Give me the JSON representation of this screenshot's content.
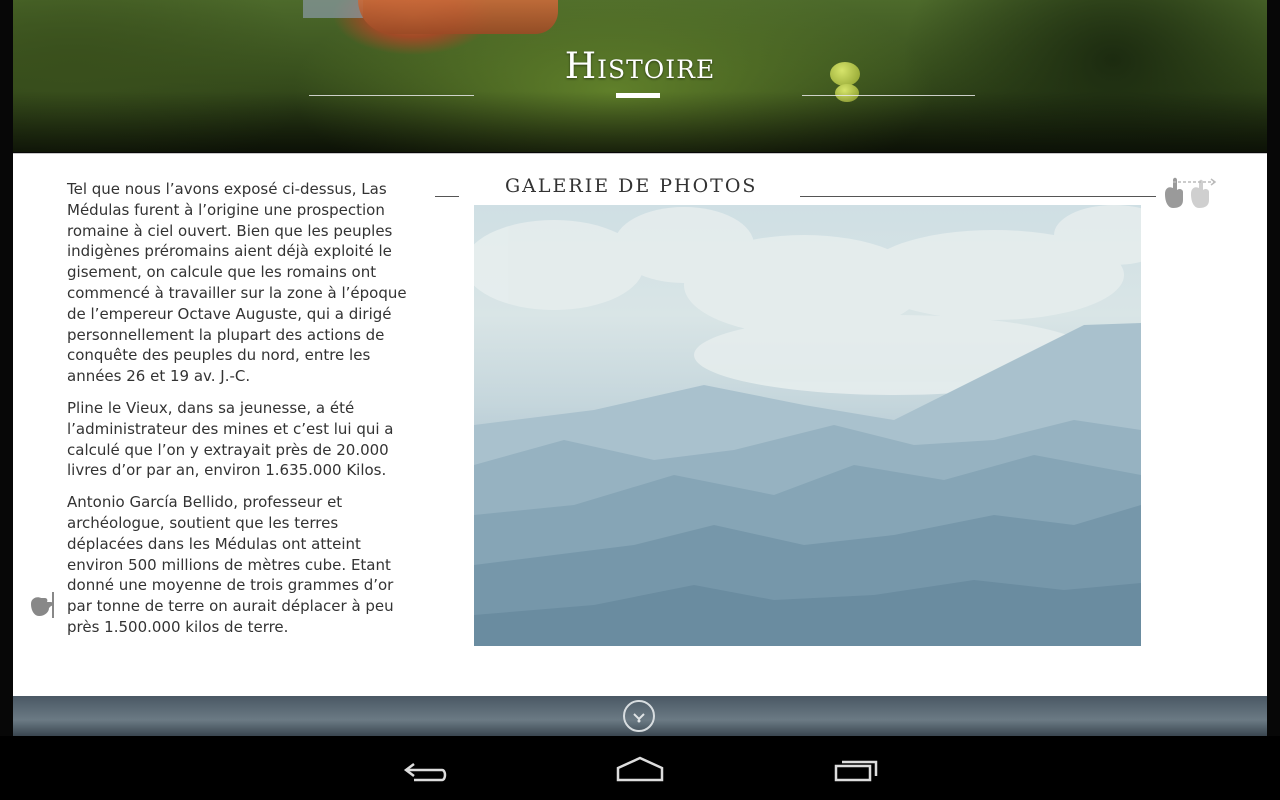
{
  "header": {
    "title": "Histoire"
  },
  "article": {
    "paragraphs": [
      "Tel que nous l’avons exposé ci-dessus, Las Médulas furent à l’origine une prospection romaine à ciel ouvert. Bien que les peuples indigènes préromains aient déjà exploité le gisement, on calcule que les romains ont commencé à travailler sur la zone à l’époque de l’empereur Octave Auguste, qui a dirigé personnellement la plupart des actions de conquête des peuples du nord, entre les années 26 et 19 av. J.-C.",
      "Pline le Vieux, dans sa jeunesse, a été l’administrateur des mines et c’est lui qui a calculé que l’on y extrayait près de 20.000 livres d’or par an, environ 1.635.000 Kilos.",
      "Antonio García Bellido,  professeur et archéologue, soutient que les terres déplacées dans les Médulas ont atteint  environ 500 millions de mètres cube. Etant donné une moyenne de trois grammes d’or par tonne de terre on aurait déplacer à peu près 1.500.000 kilos de terre."
    ]
  },
  "gallery": {
    "title": "GALERIE DE PHOTOS"
  },
  "icons": {
    "swipe": "swipe-hand-icon",
    "edge_tap": "tap-hand-icon",
    "scroll_down": "chevron-down-circle-icon",
    "nav_back": "back-icon",
    "nav_home": "home-icon",
    "nav_recent": "recent-apps-icon"
  },
  "colors": {
    "panel_bg": "#ffffff",
    "text": "#333333",
    "navbar": "#000000"
  }
}
